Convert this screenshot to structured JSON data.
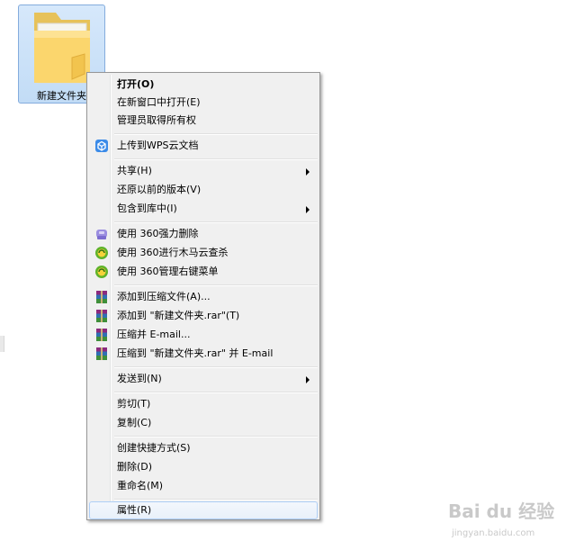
{
  "desktop": {
    "folder": {
      "label": "新建文件夹",
      "icon": "folder-icon"
    }
  },
  "context_menu": {
    "items": [
      {
        "label": "打开(O)",
        "bold": true
      },
      {
        "label": "在新窗口中打开(E)"
      },
      {
        "label": "管理员取得所有权"
      },
      {
        "label": "上传到WPS云文档",
        "icon": "wps-cloud-icon"
      },
      {
        "label": "共享(H)",
        "submenu": true
      },
      {
        "label": "还原以前的版本(V)"
      },
      {
        "label": "包含到库中(I)",
        "submenu": true
      },
      {
        "label": "使用 360强力删除",
        "icon": "360-shred-icon"
      },
      {
        "label": "使用 360进行木马云查杀",
        "icon": "360-scan-icon"
      },
      {
        "label": "使用 360管理右键菜单",
        "icon": "360-manage-icon"
      },
      {
        "label": "添加到压缩文件(A)...",
        "icon": "winrar-icon"
      },
      {
        "label": "添加到 \"新建文件夹.rar\"(T)",
        "icon": "winrar-icon"
      },
      {
        "label": "压缩并 E-mail...",
        "icon": "winrar-icon"
      },
      {
        "label": "压缩到 \"新建文件夹.rar\" 并 E-mail",
        "icon": "winrar-icon"
      },
      {
        "label": "发送到(N)",
        "submenu": true
      },
      {
        "label": "剪切(T)"
      },
      {
        "label": "复制(C)"
      },
      {
        "label": "创建快捷方式(S)"
      },
      {
        "label": "删除(D)"
      },
      {
        "label": "重命名(M)"
      },
      {
        "label": "属性(R)",
        "highlighted": true
      }
    ]
  },
  "watermark": {
    "logo": "Bai du 经验",
    "url": "jingyan.baidu.com"
  }
}
